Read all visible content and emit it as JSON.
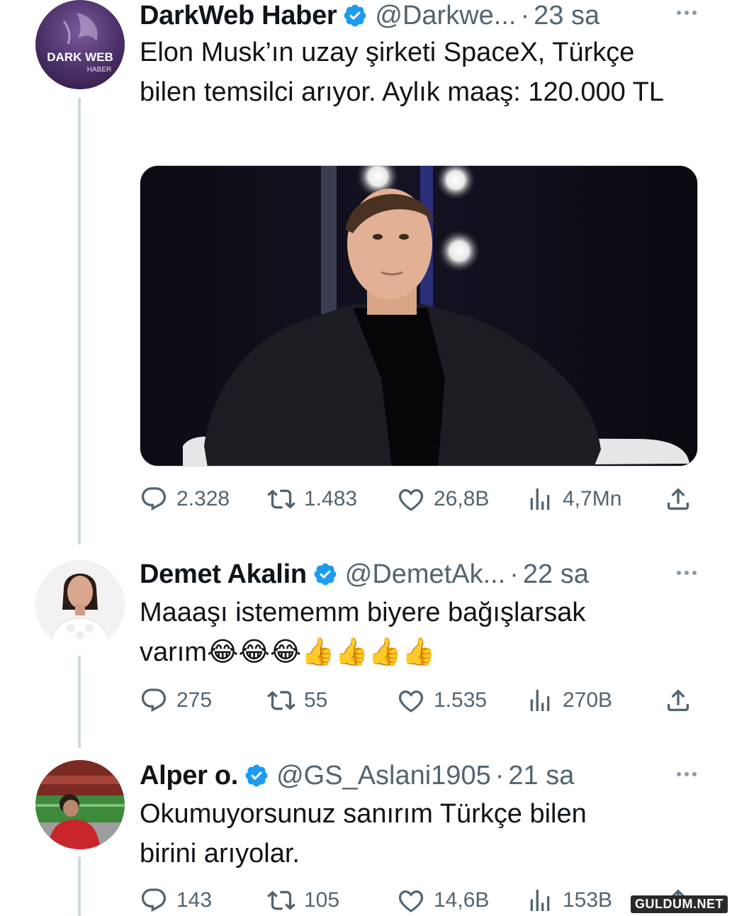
{
  "tweets": [
    {
      "name": "DarkWeb Haber",
      "handle": "@Darkwe...",
      "dot": "·",
      "time": "23 sa",
      "avatar_text_1": "DARK WEB",
      "avatar_text_2": "HABER",
      "text": "Elon Musk’ın uzay şirketi SpaceX, Türkçe bilen temsilci arıyor. Aylık maaş: 120.000 TL",
      "stats": {
        "replies": "2.328",
        "retweets": "1.483",
        "likes": "26,8B",
        "views": "4,7Mn"
      }
    },
    {
      "name": "Demet Akalin",
      "handle": "@DemetAk...",
      "dot": "·",
      "time": "22 sa",
      "text": "Maaaşı istememm biyere bağışlarsak varım😂😂😂👍👍👍👍",
      "stats": {
        "replies": "275",
        "retweets": "55",
        "likes": "1.535",
        "views": "270B"
      }
    },
    {
      "name": "Alper o.",
      "handle": "@GS_Aslani1905",
      "dot": "·",
      "time": "21 sa",
      "text": "Okumuyorsunuz sanırım Türkçe bilen birini arıyolar.",
      "stats": {
        "replies": "143",
        "retweets": "105",
        "likes": "14,6B",
        "views": "153B"
      }
    }
  ],
  "icons": {
    "verified": "verified-badge-icon",
    "reply": "reply-icon",
    "retweet": "retweet-icon",
    "like": "like-icon",
    "views": "views-icon",
    "share": "share-icon",
    "more": "more-icon"
  },
  "colors": {
    "verified": "#1d9bf0",
    "muted": "#536471",
    "text": "#0f1419"
  },
  "watermark": "GULDUM.NET"
}
